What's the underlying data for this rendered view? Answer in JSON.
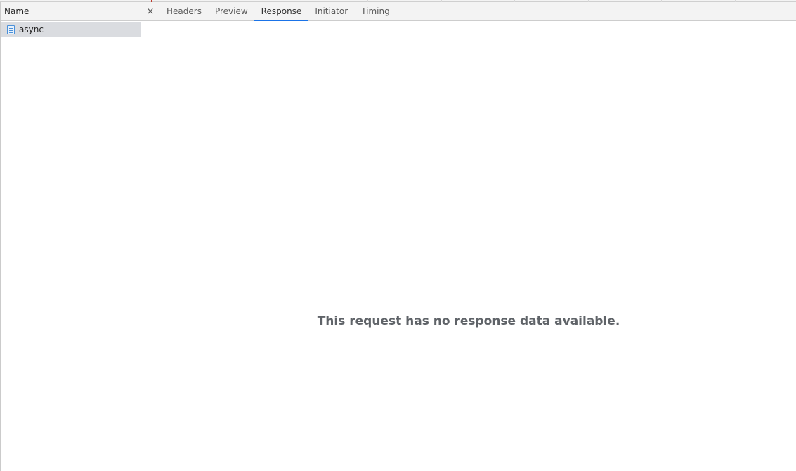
{
  "request_list": {
    "column_header": "Name",
    "requests": [
      {
        "name": "async",
        "icon": "document-icon",
        "selected": true
      }
    ]
  },
  "detail": {
    "close_glyph": "×",
    "tabs": [
      {
        "label": "Headers"
      },
      {
        "label": "Preview"
      },
      {
        "label": "Response",
        "active": true
      },
      {
        "label": "Initiator"
      },
      {
        "label": "Timing"
      }
    ],
    "empty_message": "This request has no response data available."
  },
  "colors": {
    "active_tab_underline": "#1a73e8",
    "selected_row_bg": "#dadce0"
  }
}
